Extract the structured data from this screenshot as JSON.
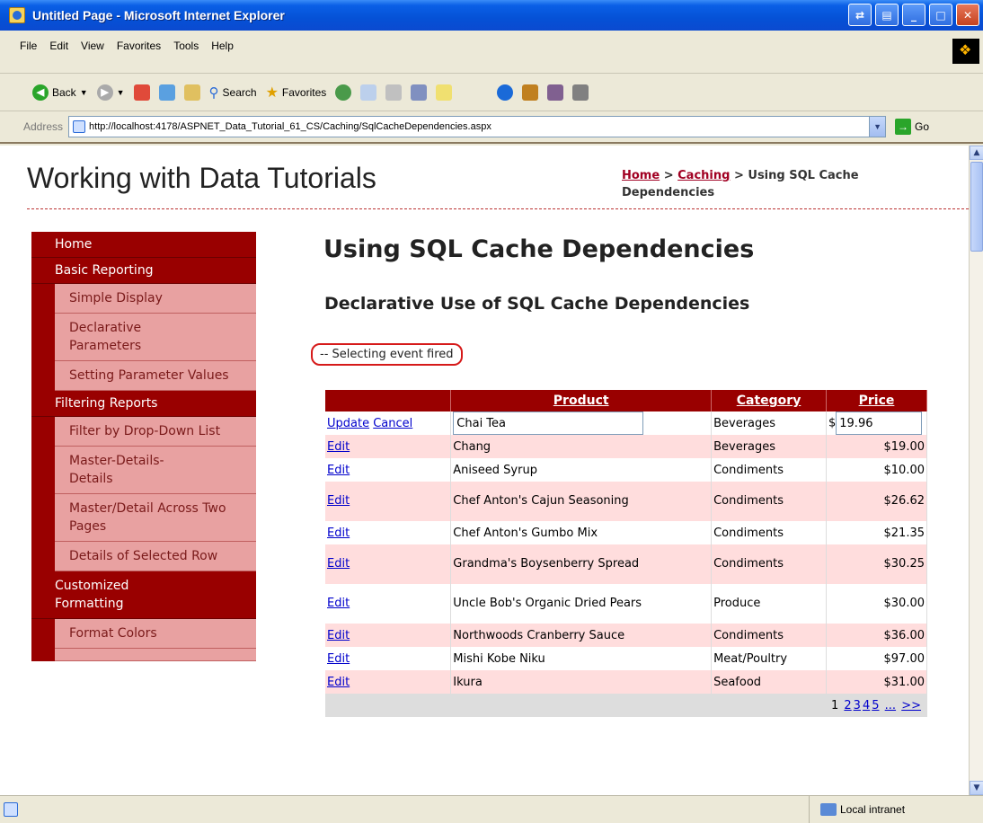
{
  "window": {
    "title": "Untitled Page - Microsoft Internet Explorer"
  },
  "menu": [
    "File",
    "Edit",
    "View",
    "Favorites",
    "Tools",
    "Help"
  ],
  "toolbar": {
    "back": "Back",
    "search": "Search",
    "favorites": "Favorites"
  },
  "address": {
    "label": "Address",
    "url": "http://localhost:4178/ASPNET_Data_Tutorial_61_CS/Caching/SqlCacheDependencies.aspx",
    "go": "Go"
  },
  "site": {
    "title": "Working with Data Tutorials",
    "breadcrumb": {
      "home": "Home",
      "sep1": " > ",
      "caching": "Caching",
      "sep2": " > ",
      "current": "Using SQL Cache Dependencies"
    }
  },
  "sidemenu": {
    "home": "Home",
    "basic_reporting": "Basic Reporting",
    "simple_display": "Simple Display",
    "declarative_parameters": "Declarative Parameters",
    "setting_parameter_values": "Setting Parameter Values",
    "filtering_reports": "Filtering Reports",
    "filter_dropdown": "Filter by Drop-Down List",
    "master_details": "Master-Details-Details",
    "master_detail_across": "Master/Detail Across Two Pages",
    "details_selected_row": "Details of Selected Row",
    "customized_formatting": "Customized Formatting",
    "format_colors": "Format Colors"
  },
  "main": {
    "heading": "Using SQL Cache Dependencies",
    "subheading": "Declarative Use of SQL Cache Dependencies",
    "status": "-- Selecting event fired"
  },
  "grid": {
    "headers": {
      "product": "Product",
      "category": "Category",
      "price": "Price"
    },
    "edit_row": {
      "update": "Update",
      "cancel": "Cancel",
      "product": "Chai Tea",
      "category": "Beverages",
      "currency": "$",
      "price": "19.96"
    },
    "edit_label": "Edit",
    "rows": [
      {
        "product": "Chang",
        "category": "Beverages",
        "price": "$19.00"
      },
      {
        "product": "Aniseed Syrup",
        "category": "Condiments",
        "price": "$10.00"
      },
      {
        "product": "Chef Anton's Cajun Seasoning",
        "category": "Condiments",
        "price": "$26.62"
      },
      {
        "product": "Chef Anton's Gumbo Mix",
        "category": "Condiments",
        "price": "$21.35"
      },
      {
        "product": "Grandma's Boysenberry Spread",
        "category": "Condiments",
        "price": "$30.25"
      },
      {
        "product": "Uncle Bob's Organic Dried Pears",
        "category": "Produce",
        "price": "$30.00"
      },
      {
        "product": "Northwoods Cranberry Sauce",
        "category": "Condiments",
        "price": "$36.00"
      },
      {
        "product": "Mishi Kobe Niku",
        "category": "Meat/Poultry",
        "price": "$97.00"
      },
      {
        "product": "Ikura",
        "category": "Seafood",
        "price": "$31.00"
      }
    ],
    "pager": {
      "current": "1",
      "p2": "2",
      "p3": "3",
      "p4": "4",
      "p5": "5",
      "more": "...",
      "next": ">>"
    }
  },
  "statusbar": {
    "zone": "Local intranet"
  }
}
